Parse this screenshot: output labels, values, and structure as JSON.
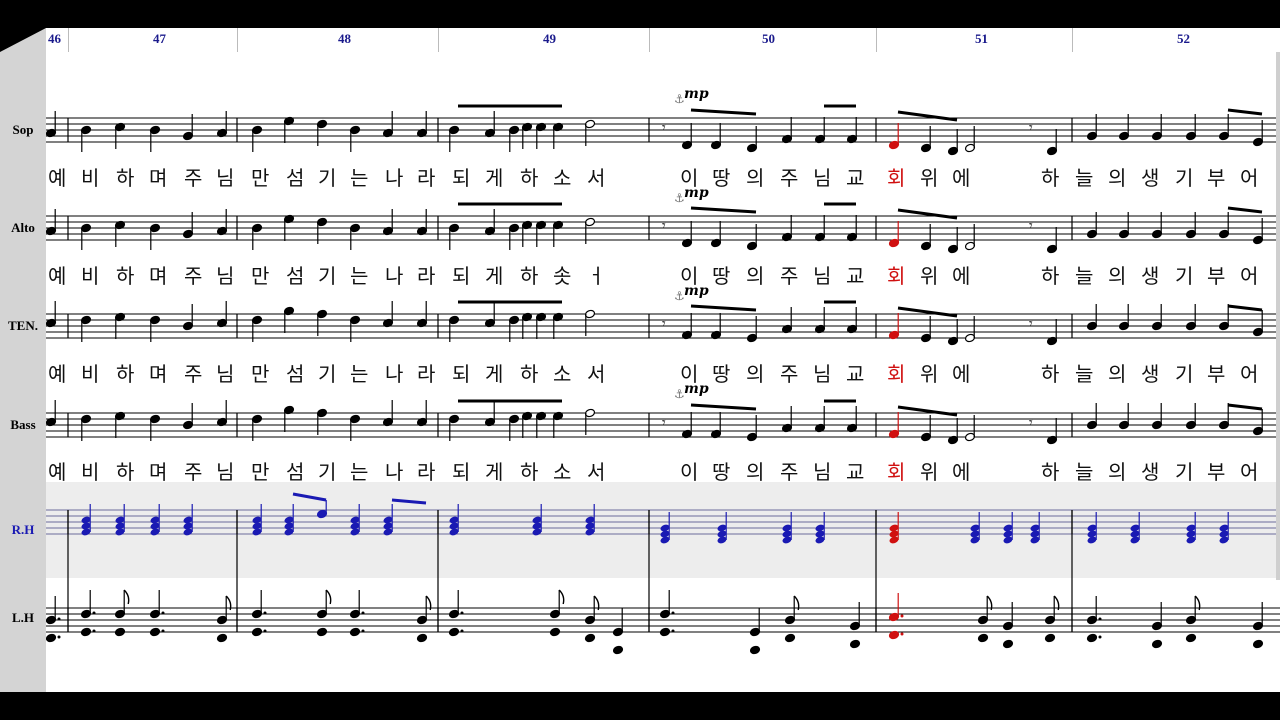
{
  "measure_numbers": [
    "46",
    "47",
    "48",
    "49",
    "50",
    "51",
    "52"
  ],
  "staves": [
    {
      "label": "Sop"
    },
    {
      "label": "Alto"
    },
    {
      "label": "TEN."
    },
    {
      "label": "Bass"
    },
    {
      "label": "R.H"
    },
    {
      "label": "L.H"
    }
  ],
  "dynamic_mark": "mp",
  "lyrics": {
    "verse": [
      "예",
      "비",
      "하",
      "며",
      "주",
      "님",
      "만",
      "섬",
      "기",
      "는",
      "나",
      "라",
      "되",
      "게",
      "하",
      "소",
      "서"
    ],
    "verse_alto_last": [
      "하",
      "솟",
      "ㅓ"
    ],
    "refrain": [
      "이",
      "땅",
      "의",
      "주",
      "님",
      "교",
      "회",
      "위",
      "에",
      "하",
      "늘",
      "의",
      "생",
      "기",
      "부",
      "어"
    ]
  },
  "highlight_word": "회",
  "colors": {
    "blue": "#1a1ab3",
    "red": "#d01010",
    "background": "#000000",
    "panel": "#d4d4d4"
  },
  "icons": {
    "anchor": "⚓"
  }
}
